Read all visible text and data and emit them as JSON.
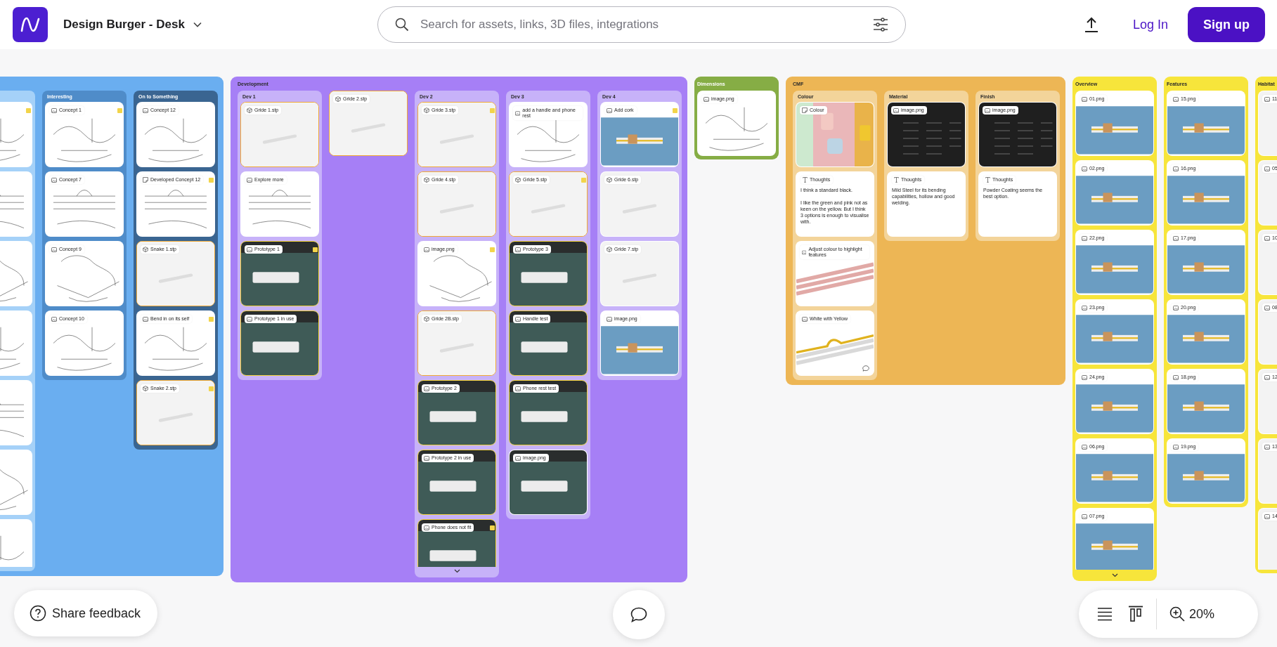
{
  "header": {
    "title": "Design Burger - Desk",
    "search": {
      "placeholder": "Search for assets, links, 3D files, integrations"
    },
    "login": "Log In",
    "signup": "Sign up"
  },
  "boards": [
    {
      "color": "#6aaef0",
      "items": [
        {
          "kind": "column",
          "color": "#a5d1f8",
          "more": false,
          "cards": [
            {
              "kind": "sketch",
              "highlight": false,
              "flag": true
            },
            {
              "kind": "sketch",
              "highlight": false,
              "flag": false
            },
            {
              "kind": "sketch",
              "highlight": false,
              "flag": false
            },
            {
              "kind": "sketch",
              "highlight": false,
              "flag": false
            },
            {
              "kind": "sketch",
              "highlight": false,
              "flag": false
            },
            {
              "kind": "sketch",
              "highlight": false,
              "flag": false
            },
            {
              "kind": "sketch",
              "highlight": false,
              "flag": false
            }
          ]
        },
        {
          "kind": "column",
          "title": "Interesting",
          "color": "#4f8cc9",
          "more": false,
          "cards": [
            {
              "label": "Concept 1",
              "kind": "sketch",
              "highlight": false,
              "flag": true
            },
            {
              "label": "Concept 7",
              "kind": "sketch",
              "highlight": false,
              "flag": false
            },
            {
              "label": "Concept 9",
              "kind": "sketch",
              "highlight": false,
              "flag": false
            },
            {
              "label": "Concept 10",
              "kind": "sketch",
              "highlight": false,
              "flag": false
            }
          ]
        },
        {
          "kind": "column",
          "title": "On to Something",
          "color": "#3a6591",
          "more": false,
          "cards": [
            {
              "label": "Concept 12",
              "kind": "sketch",
              "highlight": false,
              "flag": false
            },
            {
              "label": "Developed Concept 12",
              "kind": "memo",
              "highlight": false,
              "flag": true
            },
            {
              "label": "Snake 1.stp",
              "kind": "model",
              "highlight": true,
              "flag": false
            },
            {
              "label": "Bend in on its self",
              "kind": "sketch",
              "highlight": false,
              "flag": true
            },
            {
              "label": "Snake 2.stp",
              "kind": "model",
              "highlight": true,
              "flag": true
            }
          ]
        }
      ]
    },
    {
      "title": "Development",
      "color": "#a67ff6",
      "items": [
        {
          "kind": "column",
          "title": "Dev 1",
          "color": "#c7b2f9",
          "more": false,
          "cards": [
            {
              "label": "Gride 1.stp",
              "kind": "model",
              "highlight": true,
              "flag": false
            },
            {
              "label": "Explore more",
              "kind": "sketch",
              "highlight": false,
              "flag": false
            },
            {
              "label": "Prototype 1",
              "kind": "photo",
              "highlight": true,
              "flag": true
            },
            {
              "label": "Prototype 1 in use",
              "kind": "photo",
              "highlight": true,
              "flag": false
            }
          ]
        },
        {
          "kind": "card",
          "card": {
            "label": "Gride 2.stp",
            "kind": "model",
            "highlight": true,
            "flag": false
          }
        },
        {
          "kind": "column",
          "title": "Dev 2",
          "color": "#c7b2f9",
          "more": true,
          "cards": [
            {
              "label": "Gride 3.stp",
              "kind": "model",
              "highlight": true,
              "flag": true
            },
            {
              "label": "Gride 4.stp",
              "kind": "model",
              "highlight": true,
              "flag": false
            },
            {
              "label": "image.png",
              "kind": "sketch",
              "highlight": false,
              "flag": true
            },
            {
              "label": "Gride 2B.stp",
              "kind": "model",
              "highlight": true,
              "flag": false
            },
            {
              "label": "Prototype 2",
              "kind": "photo",
              "highlight": true,
              "flag": false
            },
            {
              "label": "Prototype 2 in use",
              "kind": "photo",
              "highlight": true,
              "flag": false
            },
            {
              "label": "Phone does not fit",
              "kind": "photo",
              "highlight": true,
              "flag": true
            }
          ]
        },
        {
          "kind": "column",
          "title": "Dev 3",
          "color": "#c7b2f9",
          "more": false,
          "cards": [
            {
              "label": "add a handle and phone rest",
              "kind": "sketch",
              "highlight": false,
              "flag": false
            },
            {
              "label": "Gride 5.stp",
              "kind": "model",
              "highlight": true,
              "flag": true
            },
            {
              "label": "Prototype 3",
              "kind": "photo",
              "highlight": true,
              "flag": false
            },
            {
              "label": "Handle test",
              "kind": "photo",
              "highlight": true,
              "flag": false
            },
            {
              "label": "Phone rest test",
              "kind": "photo",
              "highlight": true,
              "flag": false
            },
            {
              "label": "image.png",
              "kind": "photo",
              "highlight": false,
              "flag": false
            }
          ]
        },
        {
          "kind": "column",
          "title": "Dev 4",
          "color": "#c7b2f9",
          "more": false,
          "cards": [
            {
              "label": "Add cork",
              "kind": "scene",
              "highlight": false,
              "flag": true
            },
            {
              "label": "Gride 6.stp",
              "kind": "model",
              "highlight": false,
              "flag": false
            },
            {
              "label": "Gride 7.stp",
              "kind": "model",
              "highlight": false,
              "flag": false
            },
            {
              "label": "image.png",
              "kind": "scene",
              "highlight": false,
              "flag": false
            }
          ]
        }
      ]
    },
    {
      "title": "Dimensions",
      "color": "#86ad45",
      "more": false,
      "cards": [
        {
          "label": "image.png",
          "kind": "sketch",
          "highlight": false,
          "flag": false
        }
      ]
    },
    {
      "title": "CMF",
      "color": "#edb655",
      "items": [
        {
          "kind": "column",
          "title": "Colour",
          "color": "#f3d49a",
          "more": false,
          "cards": [
            {
              "label": "Colour",
              "kind": "moodboard",
              "highlight": false,
              "flag": false,
              "comment": false
            },
            {
              "label": "Thoughts",
              "kind": "text",
              "body": "I think a standard black.\n\nI like the green and pink not as keen on the yellow. But I think 3 options is enough to visualise with.",
              "highlight": false,
              "flag": false,
              "comment": false
            },
            {
              "label": "Adjust colour to highlight features",
              "kind": "pinkrender",
              "highlight": false,
              "flag": false,
              "comment": false
            },
            {
              "label": "White with Yellow",
              "kind": "yellowrender",
              "highlight": false,
              "flag": false,
              "comment": true
            }
          ]
        },
        {
          "kind": "column",
          "title": "Material",
          "color": "#f3d49a",
          "more": false,
          "cards": [
            {
              "label": "image.png",
              "kind": "table",
              "highlight": false,
              "flag": false
            },
            {
              "label": "Thoughts",
              "kind": "text",
              "body": "Mild Steel for its bending capabilities, hollow and good welding.",
              "highlight": false,
              "flag": false
            }
          ]
        },
        {
          "kind": "column",
          "title": "Finish",
          "color": "#f3d49a",
          "more": false,
          "cards": [
            {
              "label": "image.png",
              "kind": "table",
              "highlight": false,
              "flag": false
            },
            {
              "label": "Thoughts",
              "kind": "text",
              "body": "Powder Coating seems the best option.",
              "highlight": false,
              "flag": false
            }
          ]
        }
      ]
    },
    {
      "title": "Overview",
      "color": "#f7e53b",
      "more": true,
      "cards": [
        {
          "label": "01.png",
          "kind": "scene",
          "highlight": false,
          "flag": false
        },
        {
          "label": "02.png",
          "kind": "scene",
          "highlight": false,
          "flag": false
        },
        {
          "label": "22.png",
          "kind": "scene",
          "highlight": false,
          "flag": false
        },
        {
          "label": "23.png",
          "kind": "scene",
          "highlight": false,
          "flag": false
        },
        {
          "label": "24.png",
          "kind": "scene",
          "highlight": false,
          "flag": false
        },
        {
          "label": "06.png",
          "kind": "scene",
          "highlight": false,
          "flag": false
        },
        {
          "label": "07.png",
          "kind": "scene",
          "highlight": false,
          "flag": false
        }
      ]
    },
    {
      "title": "Features",
      "color": "#f7e53b",
      "more": false,
      "cards": [
        {
          "label": "15.png",
          "kind": "scene",
          "highlight": false,
          "flag": false
        },
        {
          "label": "16.png",
          "kind": "scene",
          "highlight": false,
          "flag": false
        },
        {
          "label": "17.png",
          "kind": "scene",
          "highlight": false,
          "flag": false
        },
        {
          "label": "20.png",
          "kind": "scene",
          "highlight": false,
          "flag": false
        },
        {
          "label": "18.png",
          "kind": "scene",
          "highlight": false,
          "flag": false
        },
        {
          "label": "19.png",
          "kind": "scene",
          "highlight": false,
          "flag": false
        }
      ]
    },
    {
      "title": "Habitat",
      "color": "#f7e53b",
      "more": false,
      "cards": [
        {
          "label": "11",
          "kind": "habitat",
          "highlight": false
        },
        {
          "label": "05",
          "kind": "habitat",
          "highlight": false
        },
        {
          "label": "10",
          "kind": "habitat",
          "highlight": false
        },
        {
          "label": "08",
          "kind": "habitat",
          "highlight": false
        },
        {
          "label": "12",
          "kind": "habitat",
          "highlight": false
        },
        {
          "label": "13",
          "kind": "habitat",
          "highlight": false
        },
        {
          "label": "14",
          "kind": "habitat",
          "highlight": false
        }
      ]
    }
  ],
  "feedback": "Share feedback",
  "zoom": "20%"
}
